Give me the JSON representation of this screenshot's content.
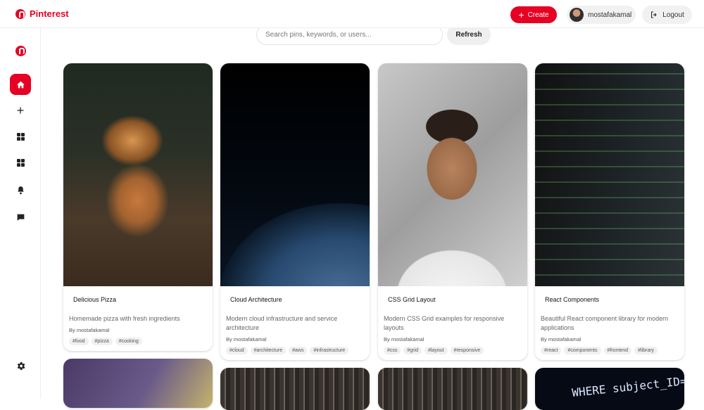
{
  "brand": {
    "name": "Pinterest"
  },
  "header": {
    "create_label": "Create",
    "username": "mostafakamal",
    "logout_label": "Logout"
  },
  "search": {
    "placeholder": "Search pins, keywords, or users...",
    "refresh_label": "Refresh"
  },
  "colors": {
    "accent": "#e60023"
  },
  "sidebar": {
    "items": [
      {
        "icon": "logo-icon"
      },
      {
        "icon": "home-icon",
        "active": true
      },
      {
        "icon": "plus-icon"
      },
      {
        "icon": "grid-icon"
      },
      {
        "icon": "grid-icon"
      },
      {
        "icon": "bell-icon"
      },
      {
        "icon": "chat-icon"
      },
      {
        "icon": "gear-icon"
      }
    ]
  },
  "pins": [
    {
      "title": "Delicious Pizza",
      "description": "Homemade pizza with fresh ingredients",
      "author": "By mostafakamal",
      "tags": [
        "#food",
        "#pizza",
        "#cooking"
      ]
    },
    {
      "title": "Cloud Architecture",
      "description": "Modern cloud infrastructure and service architecture",
      "author": "By mostafakamal",
      "tags": [
        "#cloud",
        "#architecture",
        "#aws",
        "#infrastructure"
      ]
    },
    {
      "title": "CSS Grid Layout",
      "description": "Modern CSS Grid examples for responsive layouts",
      "author": "By mostafakamal",
      "tags": [
        "#css",
        "#grid",
        "#layout",
        "#responsive"
      ]
    },
    {
      "title": "React Components",
      "description": "Beautiful React component library for modern applications",
      "author": "By mostafakamal",
      "tags": [
        "#react",
        "#components",
        "#frontend",
        "#library"
      ]
    }
  ],
  "partial_pins": {
    "sql_text": "WHERE subject_ID=\""
  }
}
